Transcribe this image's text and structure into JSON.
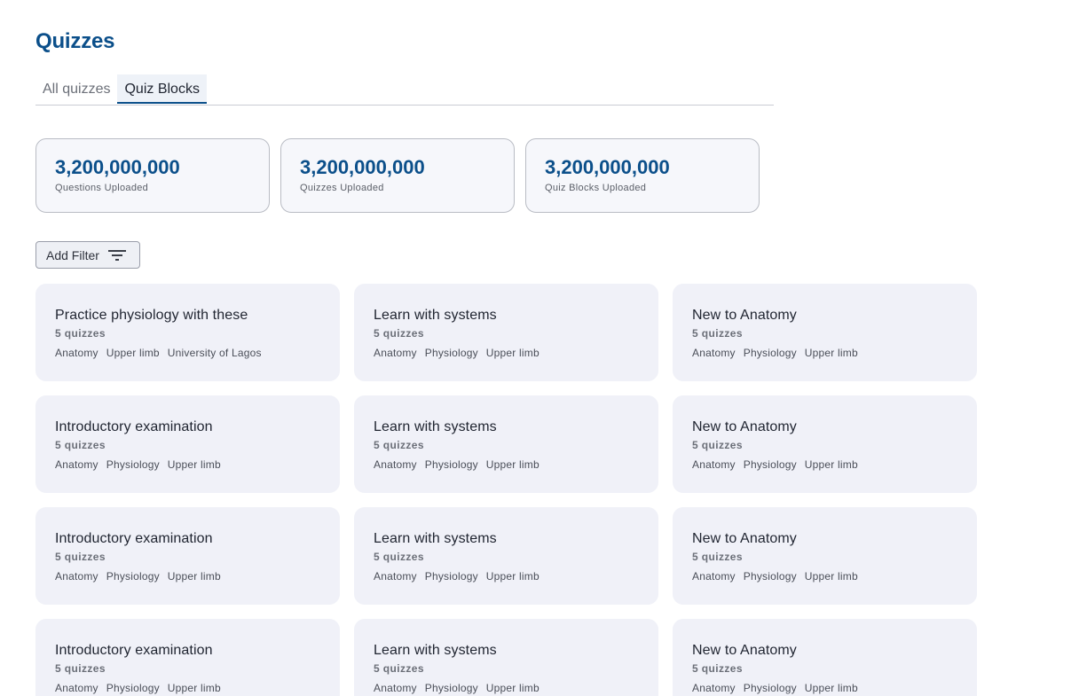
{
  "page": {
    "title": "Quizzes"
  },
  "tabs": [
    {
      "label": "All quizzes",
      "active": false
    },
    {
      "label": "Quiz Blocks",
      "active": true
    }
  ],
  "stats": [
    {
      "value": "3,200,000,000",
      "label": "Questions Uploaded"
    },
    {
      "value": "3,200,000,000",
      "label": "Quizzes Uploaded"
    },
    {
      "value": "3,200,000,000",
      "label": "Quiz Blocks Uploaded"
    }
  ],
  "filter": {
    "label": "Add Filter",
    "icon": "filter-icon"
  },
  "cards": [
    {
      "title": "Practice physiology with these",
      "count": "5 quizzes",
      "tags": [
        "Anatomy",
        "Upper limb",
        "University of Lagos"
      ]
    },
    {
      "title": "Learn with systems",
      "count": "5 quizzes",
      "tags": [
        "Anatomy",
        "Physiology",
        "Upper limb"
      ]
    },
    {
      "title": "New to Anatomy",
      "count": "5 quizzes",
      "tags": [
        "Anatomy",
        "Physiology",
        "Upper limb"
      ]
    },
    {
      "title": "Introductory examination",
      "count": "5 quizzes",
      "tags": [
        "Anatomy",
        "Physiology",
        "Upper limb"
      ]
    },
    {
      "title": "Learn with systems",
      "count": "5 quizzes",
      "tags": [
        "Anatomy",
        "Physiology",
        "Upper limb"
      ]
    },
    {
      "title": "New to Anatomy",
      "count": "5 quizzes",
      "tags": [
        "Anatomy",
        "Physiology",
        "Upper limb"
      ]
    },
    {
      "title": "Introductory examination",
      "count": "5 quizzes",
      "tags": [
        "Anatomy",
        "Physiology",
        "Upper limb"
      ]
    },
    {
      "title": "Learn with systems",
      "count": "5 quizzes",
      "tags": [
        "Anatomy",
        "Physiology",
        "Upper limb"
      ]
    },
    {
      "title": "New to Anatomy",
      "count": "5 quizzes",
      "tags": [
        "Anatomy",
        "Physiology",
        "Upper limb"
      ]
    },
    {
      "title": "Introductory examination",
      "count": "5 quizzes",
      "tags": [
        "Anatomy",
        "Physiology",
        "Upper limb"
      ]
    },
    {
      "title": "Learn with systems",
      "count": "5 quizzes",
      "tags": [
        "Anatomy",
        "Physiology",
        "Upper limb"
      ]
    },
    {
      "title": "New to Anatomy",
      "count": "5 quizzes",
      "tags": [
        "Anatomy",
        "Physiology",
        "Upper limb"
      ]
    }
  ],
  "colors": {
    "accent": "#0b4f8a",
    "card_bg": "#f0f1f8",
    "stat_bg": "#f6f7fb"
  }
}
